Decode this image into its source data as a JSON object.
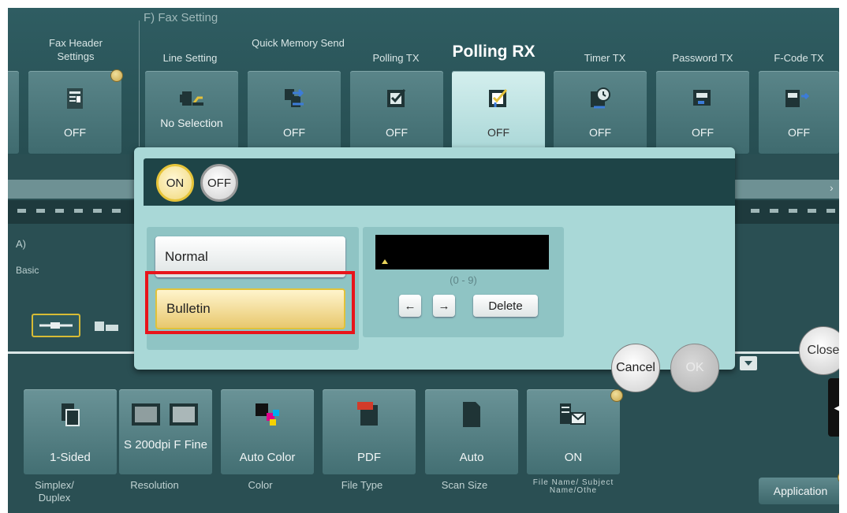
{
  "section": {
    "title": "F)   Fax Setting"
  },
  "top_tiles": [
    {
      "label": "Fax Header Settings",
      "value": "OFF"
    },
    {
      "label": "Line Setting",
      "value": "No Selection"
    },
    {
      "label": "Quick Memory Send",
      "value": "OFF"
    },
    {
      "label": "Polling TX",
      "value": "OFF"
    },
    {
      "label": "Polling RX",
      "value": "OFF"
    },
    {
      "label": "Timer TX",
      "value": "OFF"
    },
    {
      "label": "Password TX",
      "value": "OFF"
    },
    {
      "label": "F-Code TX",
      "value": "OFF"
    }
  ],
  "left_panel": {
    "section": "A)",
    "label": "Basic"
  },
  "dialog": {
    "toggle_on": "ON",
    "toggle_off": "OFF",
    "normal_label": "Normal",
    "bulletin_label": "Bulletin",
    "selected": "Bulletin",
    "number_value": "",
    "range_hint": "(0 - 9)",
    "left_arrow": "←",
    "right_arrow": "→",
    "delete_label": "Delete"
  },
  "actions": {
    "cancel": "Cancel",
    "ok": "OK",
    "close": "Close"
  },
  "bottom_tiles": [
    {
      "value": "1-Sided",
      "label": "Simplex/ Duplex"
    },
    {
      "value": "S 200dpi F Fine",
      "label": "Resolution"
    },
    {
      "value": "Auto Color",
      "label": "Color"
    },
    {
      "value": "PDF",
      "label": "File Type"
    },
    {
      "value": "Auto",
      "label": "Scan Size"
    },
    {
      "value": "ON",
      "label": "File Name/ Subject Name/Othe"
    }
  ],
  "application_label": "Application",
  "colors": {
    "accent_yellow": "#e6c43a",
    "highlight_red": "#e8141b",
    "dialog_bg": "#a9d8d7",
    "screen_bg": "#2a4f53"
  },
  "icons": [
    "header-doc-icon",
    "fax-line-icon",
    "quick-memory-icon",
    "polling-tx-icon",
    "polling-rx-icon",
    "timer-icon",
    "password-icon",
    "fcode-icon",
    "duplex-icon",
    "resolution-icon",
    "color-icon",
    "pdf-icon",
    "scan-size-icon",
    "file-name-icon"
  ]
}
